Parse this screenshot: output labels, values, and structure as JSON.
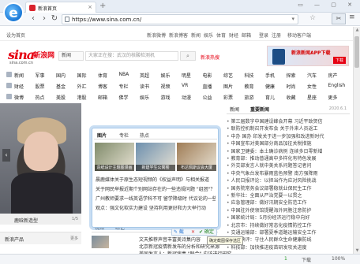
{
  "browser": {
    "tab_title": "新浪首页",
    "url": "https://www.sina.com.cn/",
    "tab_close": "×",
    "new_tab": "+",
    "window_controls": "▭ — ▢ ✕"
  },
  "site_top": {
    "left": "设为首页",
    "links": [
      "新浪微博",
      "新浪博客",
      "新闻",
      "娱乐",
      "体育",
      "财经",
      "邮箱",
      "登录",
      "注册",
      "移动客户端"
    ]
  },
  "header": {
    "logo": "sina",
    "logo_cn": "新浪网",
    "domain": "sina.com.cn",
    "search_select": "新闻",
    "search_placeholder": "大家正在搜：武汉的核酸检测机",
    "hot": "新浪热搜",
    "ad_text": "新浪新闻APP下载",
    "ad_button": "下载"
  },
  "nav": {
    "rows": [
      [
        "新闻",
        "军事",
        "国内",
        "国际",
        "体育",
        "NBA",
        "英超",
        "娱乐",
        "明星",
        "电影",
        "综艺",
        "科技",
        "手机",
        "探索",
        "汽车",
        "房产"
      ],
      [
        "财经",
        "股票",
        "基金",
        "外汇",
        "博客",
        "专栏",
        "读书",
        "视频",
        "VR",
        "直播",
        "图片",
        "教育",
        "健康",
        "时尚",
        "女性",
        "English"
      ],
      [
        "微博",
        "热点",
        "美股",
        "港股",
        "邮箱",
        "佛学",
        "娱乐",
        "游戏",
        "动漫",
        "公益",
        "彩票",
        "旅游",
        "育儿",
        "收藏",
        "星座",
        "更多"
      ]
    ]
  },
  "hero": {
    "caption": "鹿晗新造型",
    "count": "1/5",
    "arrow": "‹",
    "products": "新浪产品",
    "products_more": "更多"
  },
  "popup": {
    "tabs": [
      "图片",
      "专栏",
      "热点"
    ],
    "images": [
      {
        "caption": "造纸设计主题图漫画",
        "color": "#7f8b6a"
      },
      {
        "caption": "新建学生公寓楼",
        "color": "#6c8fae"
      },
      {
        "caption": "布达佩斯议会大厦",
        "color": "#9f7c55"
      }
    ],
    "lines": [
      "晨鹿媒体关于原生态短视频的《权益声明》与相关报道",
      "关于网民举报近期个别网站存在的一些违规问题 \"组团\"？",
      "广州教师要求一线英语学科不可 留学降级时 代议论的一些问题",
      "观点：强文化软实力建设 坚持利用更好和力大举行动"
    ]
  },
  "clipbar": {
    "items": [
      "✎ 截",
      "✕",
      "✔ 确定"
    ],
    "tip": "确定截图保存选区"
  },
  "mid_tabs": [
    "视频",
    "综艺"
  ],
  "mid_lines": [
    "文天推荐声音丰富美诗集内容",
    "北京新冠疫情新发布的分析和研究来源",
    "美国发言人：新冠病毒 \"联合\" 应该进行研究"
  ],
  "right": {
    "tabs": [
      "新闻",
      "重要新闻"
    ],
    "date": "2020.6.1",
    "lines": [
      "第三届数字中国建设峰会开幕 习近平致贺信",
      "联防控机制召开发布会 关于外来人员返工",
      "中办 国办 印发关于进一步加强和改进新时代",
      "中国宣布对美国部分商品加征关税措施",
      "国家卫健委：本土确诊病例 连续多日零新增",
      "教育部：推动普通高中多样化有特色发展",
      "外交部发言人就中美关系问题答记者问",
      "中央气象台发布暴雨蓝色预警 南方强降雨",
      "人民日报评论：以担当作为应对风险挑战",
      "国务院常务会议部署稳就业保民生工作",
      "新华社：全面从严治党要一以贯之",
      "应急管理部：做好汛期安全防范工作",
      "中国驻外使领馆提醒海外同胞注意防护",
      "国家统计局：5月份经济运行稳中向好",
      "北京市：持续做好常态化疫情防控工作",
      "交通运输部：部署夏季道路运输安全工作",
      "央视快评：守住人民群众生命健康防线",
      "科技部：加快推进疫苗研发攻关进度"
    ]
  },
  "status": {
    "count": "1",
    "downloads": "下载",
    "zoom": "100%"
  }
}
